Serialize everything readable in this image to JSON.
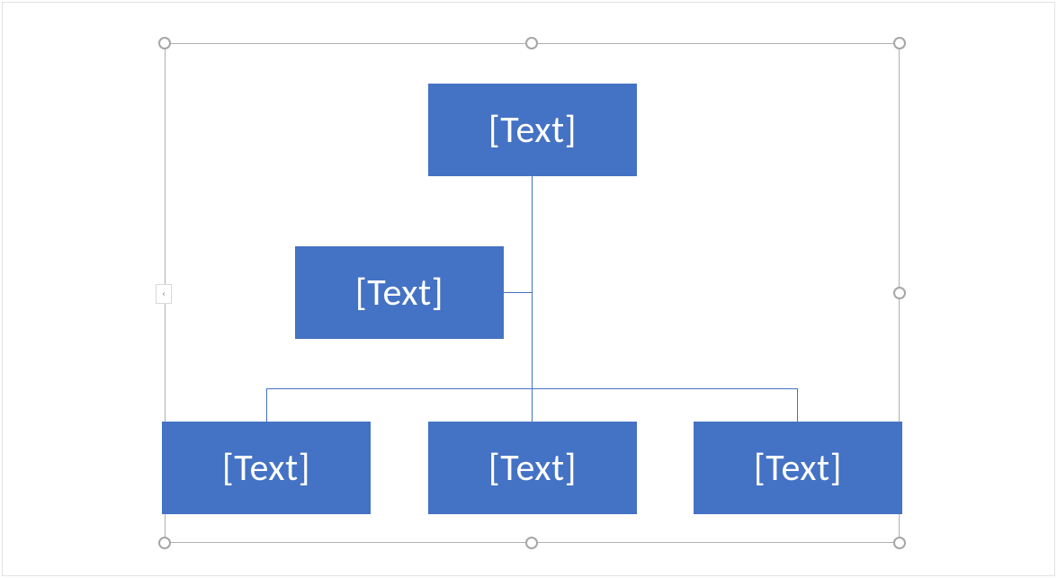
{
  "diagram": {
    "type": "org-chart",
    "colors": {
      "node_fill": "#4472c4",
      "node_text": "#ffffff",
      "connector": "#4472c4",
      "selection_border": "#b0b0b0",
      "handle_border": "#a6a6a6"
    },
    "nodes": {
      "root": {
        "label": "[Text]"
      },
      "assistant": {
        "label": "[Text]"
      },
      "child_left": {
        "label": "[Text]"
      },
      "child_mid": {
        "label": "[Text]"
      },
      "child_right": {
        "label": "[Text]"
      }
    },
    "expand_tab": {
      "glyph": "‹"
    }
  }
}
